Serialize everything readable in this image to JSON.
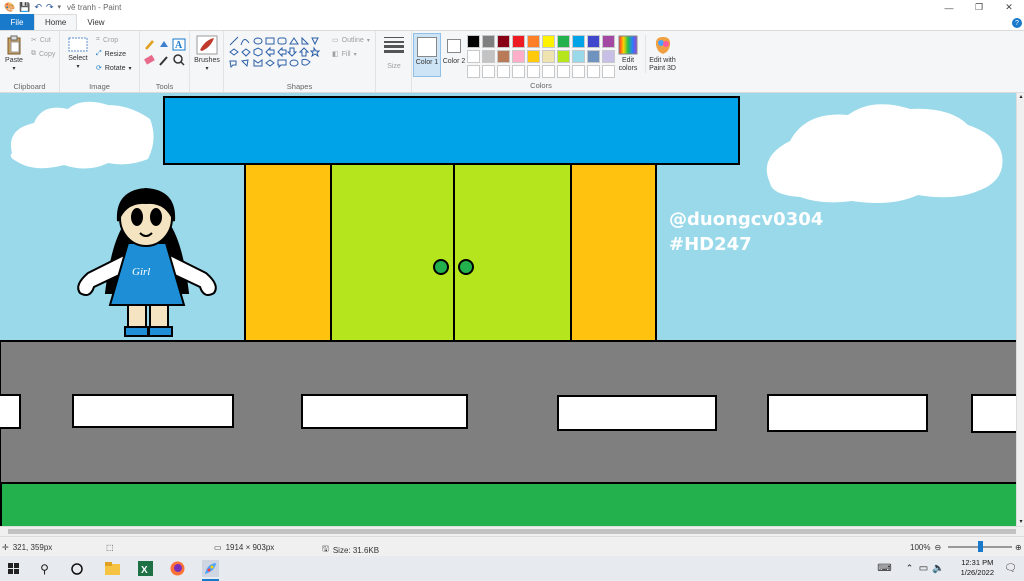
{
  "window": {
    "title": "vẽ tranh - Paint",
    "controls": [
      "—",
      "❐",
      "✕"
    ]
  },
  "menu": {
    "tabs": [
      {
        "label": "File"
      },
      {
        "label": "Home"
      },
      {
        "label": "View"
      }
    ]
  },
  "ribbon": {
    "clipboard": {
      "label": "Clipboard",
      "paste": "Paste",
      "cut": "Cut",
      "copy": "Copy"
    },
    "image": {
      "label": "Image",
      "select": "Select",
      "crop": "Crop",
      "resize": "Resize",
      "rotate": "Rotate"
    },
    "tools": {
      "label": "Tools"
    },
    "brushes": {
      "label": "Brushes"
    },
    "shapes": {
      "label": "Shapes",
      "outline": "Outline",
      "fill": "Fill"
    },
    "size": {
      "label": "Size"
    },
    "color1": {
      "label": "Color 1"
    },
    "color2": {
      "label": "Color 2"
    },
    "colors": {
      "label": "Colors"
    },
    "edit_colors": {
      "label": "Edit colors"
    },
    "edit_3d": {
      "label": "Edit with Paint 3D"
    },
    "palette": [
      "#000000",
      "#7f7f7f",
      "#880015",
      "#ed1c24",
      "#ff7f27",
      "#fff200",
      "#22b14c",
      "#00a2e8",
      "#3f48cc",
      "#a349a4",
      "#ffffff",
      "#c3c3c3",
      "#b97a57",
      "#ffaec9",
      "#ffc90e",
      "#efe4b0",
      "#b5e61d",
      "#99d9ea",
      "#7092be",
      "#c8bfe7",
      "#ffffff",
      "#ffffff",
      "#ffffff",
      "#ffffff",
      "#ffffff",
      "#ffffff",
      "#ffffff",
      "#ffffff",
      "#ffffff",
      "#ffffff"
    ]
  },
  "drawing": {
    "handle": "@duongcv0304",
    "hashtag": "#HD247",
    "shirt_text": "Girl",
    "colors": {
      "sky": "#99d9ea",
      "roof": "#00a2e8",
      "pillar": "#ffc20e",
      "door": "#b5e61d",
      "knob": "#22b14c",
      "road": "#7f7f7f",
      "grass": "#22b14c",
      "dress": "#1e8fd6",
      "skin": "#f4e4c1",
      "hair": "#000000"
    }
  },
  "status": {
    "cursor": "321, 359px",
    "dimensions": "1914 × 903px",
    "size": "Size: 31.6KB",
    "zoom": "100%",
    "zoom_level": 0.5
  },
  "taskbar": {
    "time": "12:31 PM",
    "date": "1/26/2022"
  }
}
